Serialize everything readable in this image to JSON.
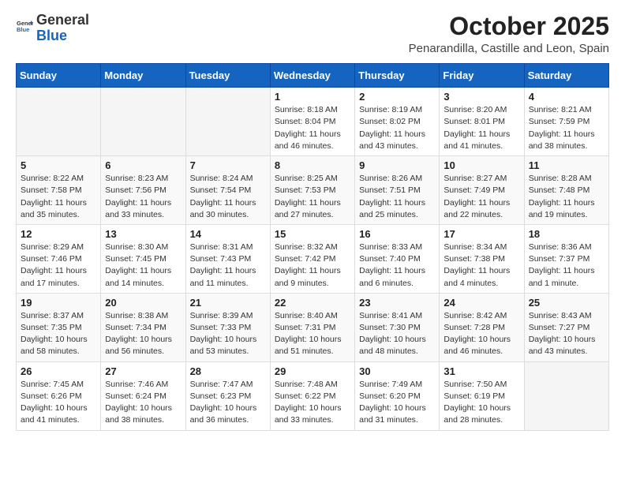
{
  "header": {
    "logo_general": "General",
    "logo_blue": "Blue",
    "title": "October 2025",
    "subtitle": "Penarandilla, Castille and Leon, Spain"
  },
  "weekdays": [
    "Sunday",
    "Monday",
    "Tuesday",
    "Wednesday",
    "Thursday",
    "Friday",
    "Saturday"
  ],
  "weeks": [
    [
      {
        "day": "",
        "info": ""
      },
      {
        "day": "",
        "info": ""
      },
      {
        "day": "",
        "info": ""
      },
      {
        "day": "1",
        "info": "Sunrise: 8:18 AM\nSunset: 8:04 PM\nDaylight: 11 hours\nand 46 minutes."
      },
      {
        "day": "2",
        "info": "Sunrise: 8:19 AM\nSunset: 8:02 PM\nDaylight: 11 hours\nand 43 minutes."
      },
      {
        "day": "3",
        "info": "Sunrise: 8:20 AM\nSunset: 8:01 PM\nDaylight: 11 hours\nand 41 minutes."
      },
      {
        "day": "4",
        "info": "Sunrise: 8:21 AM\nSunset: 7:59 PM\nDaylight: 11 hours\nand 38 minutes."
      }
    ],
    [
      {
        "day": "5",
        "info": "Sunrise: 8:22 AM\nSunset: 7:58 PM\nDaylight: 11 hours\nand 35 minutes."
      },
      {
        "day": "6",
        "info": "Sunrise: 8:23 AM\nSunset: 7:56 PM\nDaylight: 11 hours\nand 33 minutes."
      },
      {
        "day": "7",
        "info": "Sunrise: 8:24 AM\nSunset: 7:54 PM\nDaylight: 11 hours\nand 30 minutes."
      },
      {
        "day": "8",
        "info": "Sunrise: 8:25 AM\nSunset: 7:53 PM\nDaylight: 11 hours\nand 27 minutes."
      },
      {
        "day": "9",
        "info": "Sunrise: 8:26 AM\nSunset: 7:51 PM\nDaylight: 11 hours\nand 25 minutes."
      },
      {
        "day": "10",
        "info": "Sunrise: 8:27 AM\nSunset: 7:49 PM\nDaylight: 11 hours\nand 22 minutes."
      },
      {
        "day": "11",
        "info": "Sunrise: 8:28 AM\nSunset: 7:48 PM\nDaylight: 11 hours\nand 19 minutes."
      }
    ],
    [
      {
        "day": "12",
        "info": "Sunrise: 8:29 AM\nSunset: 7:46 PM\nDaylight: 11 hours\nand 17 minutes."
      },
      {
        "day": "13",
        "info": "Sunrise: 8:30 AM\nSunset: 7:45 PM\nDaylight: 11 hours\nand 14 minutes."
      },
      {
        "day": "14",
        "info": "Sunrise: 8:31 AM\nSunset: 7:43 PM\nDaylight: 11 hours\nand 11 minutes."
      },
      {
        "day": "15",
        "info": "Sunrise: 8:32 AM\nSunset: 7:42 PM\nDaylight: 11 hours\nand 9 minutes."
      },
      {
        "day": "16",
        "info": "Sunrise: 8:33 AM\nSunset: 7:40 PM\nDaylight: 11 hours\nand 6 minutes."
      },
      {
        "day": "17",
        "info": "Sunrise: 8:34 AM\nSunset: 7:38 PM\nDaylight: 11 hours\nand 4 minutes."
      },
      {
        "day": "18",
        "info": "Sunrise: 8:36 AM\nSunset: 7:37 PM\nDaylight: 11 hours\nand 1 minute."
      }
    ],
    [
      {
        "day": "19",
        "info": "Sunrise: 8:37 AM\nSunset: 7:35 PM\nDaylight: 10 hours\nand 58 minutes."
      },
      {
        "day": "20",
        "info": "Sunrise: 8:38 AM\nSunset: 7:34 PM\nDaylight: 10 hours\nand 56 minutes."
      },
      {
        "day": "21",
        "info": "Sunrise: 8:39 AM\nSunset: 7:33 PM\nDaylight: 10 hours\nand 53 minutes."
      },
      {
        "day": "22",
        "info": "Sunrise: 8:40 AM\nSunset: 7:31 PM\nDaylight: 10 hours\nand 51 minutes."
      },
      {
        "day": "23",
        "info": "Sunrise: 8:41 AM\nSunset: 7:30 PM\nDaylight: 10 hours\nand 48 minutes."
      },
      {
        "day": "24",
        "info": "Sunrise: 8:42 AM\nSunset: 7:28 PM\nDaylight: 10 hours\nand 46 minutes."
      },
      {
        "day": "25",
        "info": "Sunrise: 8:43 AM\nSunset: 7:27 PM\nDaylight: 10 hours\nand 43 minutes."
      }
    ],
    [
      {
        "day": "26",
        "info": "Sunrise: 7:45 AM\nSunset: 6:26 PM\nDaylight: 10 hours\nand 41 minutes."
      },
      {
        "day": "27",
        "info": "Sunrise: 7:46 AM\nSunset: 6:24 PM\nDaylight: 10 hours\nand 38 minutes."
      },
      {
        "day": "28",
        "info": "Sunrise: 7:47 AM\nSunset: 6:23 PM\nDaylight: 10 hours\nand 36 minutes."
      },
      {
        "day": "29",
        "info": "Sunrise: 7:48 AM\nSunset: 6:22 PM\nDaylight: 10 hours\nand 33 minutes."
      },
      {
        "day": "30",
        "info": "Sunrise: 7:49 AM\nSunset: 6:20 PM\nDaylight: 10 hours\nand 31 minutes."
      },
      {
        "day": "31",
        "info": "Sunrise: 7:50 AM\nSunset: 6:19 PM\nDaylight: 10 hours\nand 28 minutes."
      },
      {
        "day": "",
        "info": ""
      }
    ]
  ]
}
